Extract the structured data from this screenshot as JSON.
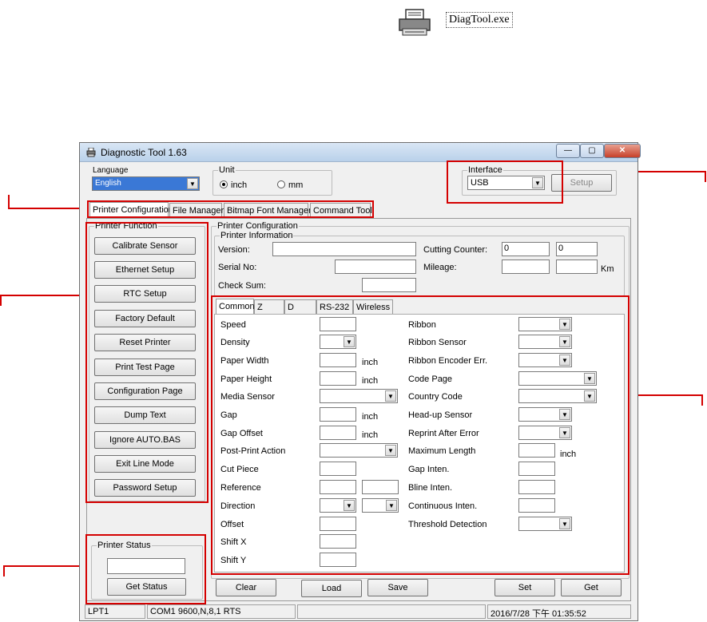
{
  "desktop": {
    "exe_label": "DiagTool.exe"
  },
  "window": {
    "title": "Diagnostic Tool 1.63",
    "controls": {
      "minimize": "—",
      "maximize": "▢",
      "close": "✕"
    }
  },
  "language": {
    "label": "Language",
    "value": "English"
  },
  "unit": {
    "label": "Unit",
    "options": [
      "inch",
      "mm"
    ],
    "selected": "inch"
  },
  "interface": {
    "label": "Interface",
    "value": "USB",
    "setup_label": "Setup"
  },
  "main_tabs": [
    "Printer Configuration",
    "File Manager",
    "Bitmap Font Manager",
    "Command Tool"
  ],
  "printer_function": {
    "label": "Printer Function",
    "buttons": [
      "Calibrate Sensor",
      "Ethernet Setup",
      "RTC Setup",
      "Factory Default",
      "Reset Printer",
      "Print Test Page",
      "Configuration Page",
      "Dump Text",
      "Ignore AUTO.BAS",
      "Exit Line Mode",
      "Password Setup"
    ]
  },
  "printer_status": {
    "label": "Printer Status",
    "get_status_label": "Get Status"
  },
  "config": {
    "label": "Printer Configuration",
    "info_label": "Printer Information",
    "version_label": "Version:",
    "serial_label": "Serial No:",
    "checksum_label": "Check Sum:",
    "cutting_label": "Cutting Counter:",
    "cutting_values": [
      "0",
      "0"
    ],
    "mileage_label": "Mileage:",
    "km_label": "Km"
  },
  "sub_tabs": [
    "Common",
    "Z",
    "D",
    "RS-232",
    "Wireless"
  ],
  "left_fields": [
    "Speed",
    "Density",
    "Paper Width",
    "Paper Height",
    "Media Sensor",
    "Gap",
    "Gap Offset",
    "Post-Print Action",
    "Cut Piece",
    "Reference",
    "Direction",
    "Offset",
    "Shift X",
    "Shift Y"
  ],
  "right_fields": [
    "Ribbon",
    "Ribbon Sensor",
    "Ribbon Encoder Err.",
    "Code Page",
    "Country Code",
    "Head-up Sensor",
    "Reprint After Error",
    "Maximum Length",
    "Gap Inten.",
    "Bline Inten.",
    "Continuous Inten.",
    "Threshold Detection"
  ],
  "unit_inch": "inch",
  "bottom_buttons": [
    "Clear",
    "Load",
    "Save",
    "Set",
    "Get"
  ],
  "status_bar": [
    "LPT1",
    "COM1 9600,N,8,1 RTS",
    "",
    "2016/7/28 下午 01:35:52"
  ]
}
